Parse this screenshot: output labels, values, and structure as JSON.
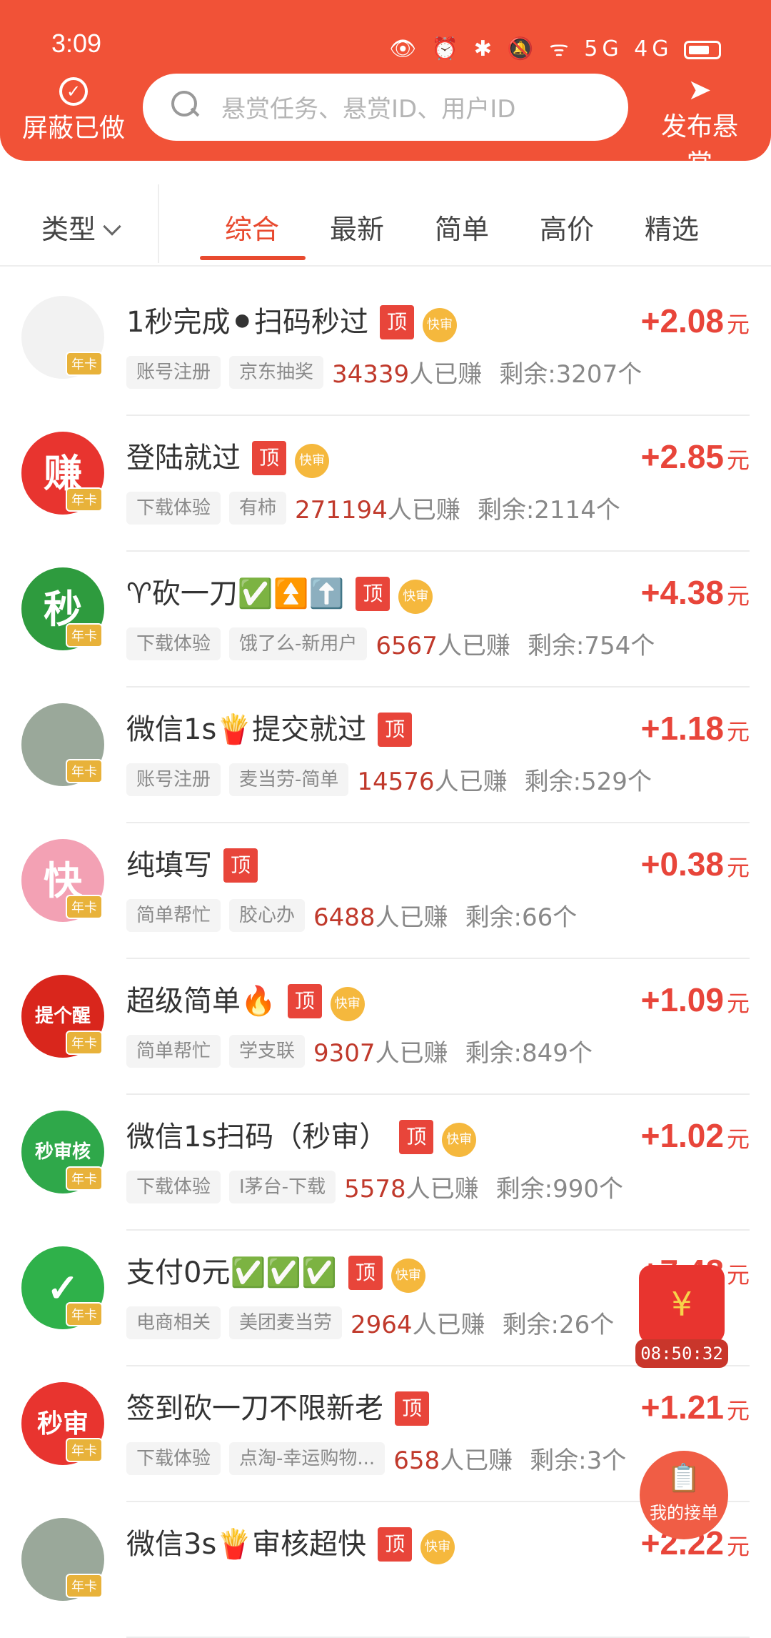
{
  "status": {
    "time": "3:09",
    "icons": "👁 ⏰ ✱ 🔕 ᯤ 5G 4G"
  },
  "header": {
    "left_icon": "check-circle-icon",
    "left_label": "屏蔽已做",
    "search_placeholder": "悬赏任务、悬赏ID、用户ID",
    "right_icon": "paper-plane-icon",
    "right_label": "发布悬赏"
  },
  "filter": {
    "type_label": "类型",
    "tabs": [
      "综合",
      "最新",
      "简单",
      "高价",
      "精选"
    ],
    "active_tab": "综合"
  },
  "badges": {
    "top": "顶",
    "fast": "快审",
    "vip": "年卡"
  },
  "earned_suffix": "人已赚",
  "remain_prefix": "剩余:",
  "remain_suffix": "个",
  "currency": "元",
  "items": [
    {
      "avatar_text": "",
      "avatar_color": "#f2f2f2",
      "title": "1秒完成⚫扫码秒过",
      "has_fast": true,
      "price": "+2.08",
      "chip1": "账号注册",
      "chip2": "京东抽奖",
      "earned": "34339",
      "remain": "3207"
    },
    {
      "avatar_text": "赚",
      "avatar_color": "#e8342f",
      "title": "登陆就过",
      "has_fast": true,
      "price": "+2.85",
      "chip1": "下载体验",
      "chip2": "有柿",
      "earned": "271194",
      "remain": "2114"
    },
    {
      "avatar_text": "秒",
      "avatar_color": "#2e9b3e",
      "title": "♈砍一刀✅⏫⬆️",
      "has_fast": true,
      "price": "+4.38",
      "chip1": "下载体验",
      "chip2": "饿了么-新用户",
      "earned": "6567",
      "remain": "754"
    },
    {
      "avatar_text": "",
      "avatar_color": "#9aa89a",
      "title": "微信1s🍟提交就过",
      "has_fast": false,
      "price": "+1.18",
      "chip1": "账号注册",
      "chip2": "麦当劳-简单",
      "earned": "14576",
      "remain": "529"
    },
    {
      "avatar_text": "快",
      "avatar_color": "#f3a1b4",
      "title": "纯填写",
      "has_fast": false,
      "price": "+0.38",
      "chip1": "简单帮忙",
      "chip2": "胶心办",
      "earned": "6488",
      "remain": "66"
    },
    {
      "avatar_text": "提个醒",
      "avatar_color": "#d9261c",
      "title": "超级简单🔥",
      "has_fast": true,
      "price": "+1.09",
      "chip1": "简单帮忙",
      "chip2": "学支联",
      "earned": "9307",
      "remain": "849"
    },
    {
      "avatar_text": "秒审核",
      "avatar_color": "#2fa84a",
      "title": "微信1s扫码（秒审）",
      "has_fast": true,
      "price": "+1.02",
      "chip1": "下载体验",
      "chip2": "I茅台-下载",
      "earned": "5578",
      "remain": "990"
    },
    {
      "avatar_text": "✓",
      "avatar_color": "#2fb14a",
      "title": "支付0元✅✅✅",
      "has_fast": true,
      "price": "+7.48",
      "chip1": "电商相关",
      "chip2": "美团麦当劳",
      "earned": "2964",
      "remain": "26"
    },
    {
      "avatar_text": "秒审",
      "avatar_color": "#e8342f",
      "title": "签到砍一刀不限新老",
      "has_fast": false,
      "price": "+1.21",
      "chip1": "下载体验",
      "chip2": "点淘-幸运购物...",
      "earned": "658",
      "remain": "3"
    },
    {
      "avatar_text": "",
      "avatar_color": "#9aa89a",
      "title": "微信3s🍟审核超快",
      "has_fast": true,
      "price": "+2.22",
      "chip1": "",
      "chip2": "",
      "earned": "",
      "remain": ""
    }
  ],
  "float_gift": {
    "icon": "red-envelope-icon",
    "timer": "08:50:32"
  },
  "float_order": {
    "icon": "clipboard-check-icon",
    "label": "我的接单"
  }
}
